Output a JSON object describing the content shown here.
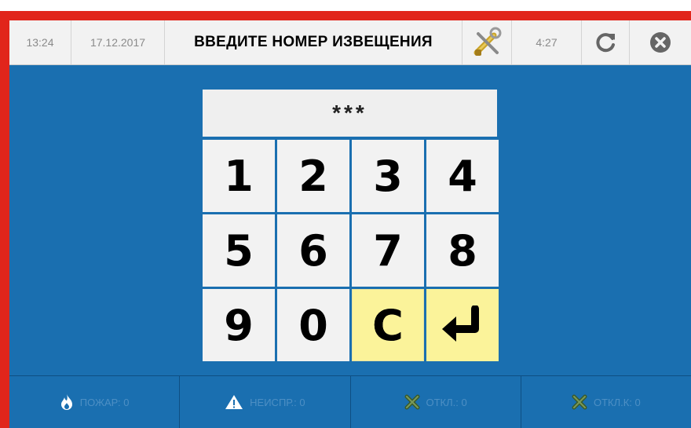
{
  "header": {
    "time": "13:24",
    "date": "17.12.2017",
    "title": "ВВЕДИТЕ НОМЕР ИЗВЕЩЕНИЯ",
    "timer": "4:27",
    "tools_icon": "tools-icon",
    "refresh_icon": "refresh-icon",
    "close_icon": "close-circle-icon"
  },
  "display": {
    "value": "***"
  },
  "keypad": {
    "keys": [
      "1",
      "2",
      "3",
      "4",
      "5",
      "6",
      "7",
      "8",
      "9",
      "0",
      "C",
      "↵"
    ],
    "enter_icon": "enter-arrow-icon"
  },
  "status": {
    "fire_label": "ПОЖАР: 0",
    "fault_label": "НЕИСПР.: 0",
    "off_label": "ОТКЛ.: 0",
    "offk_label": "ОТКЛ.К: 0",
    "fire_icon": "fire-icon",
    "fault_icon": "warning-icon",
    "off_icon": "cross-icon",
    "offk_icon": "cross-icon"
  },
  "colors": {
    "frame": "#e1251b",
    "background": "#1a6fb0",
    "key": "#f2f2f2",
    "key_accent": "#fbf39a"
  }
}
